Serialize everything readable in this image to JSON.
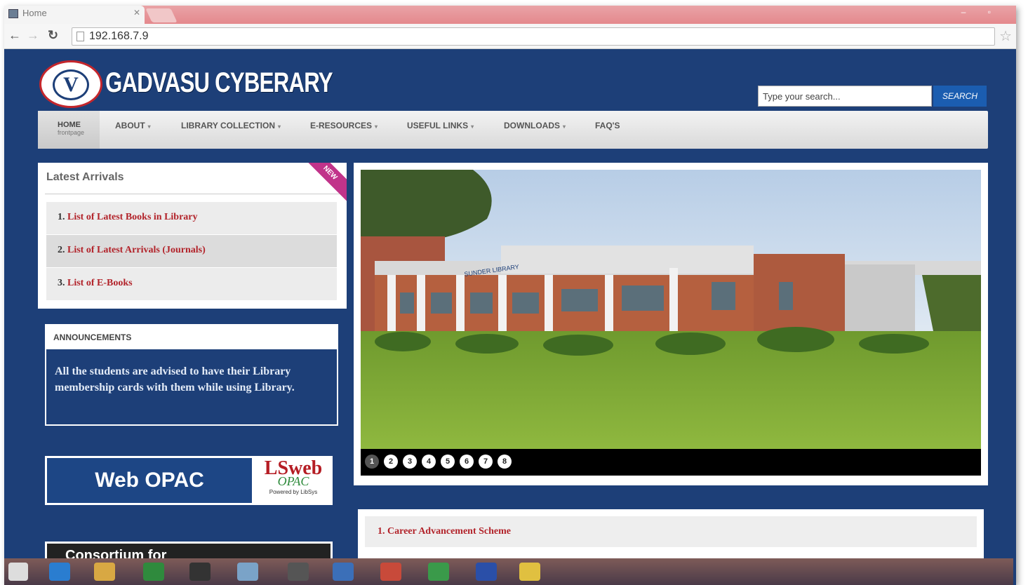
{
  "browser": {
    "tab_title": "Home",
    "url": "192.168.7.9"
  },
  "header": {
    "site_title": "GADVASU CYBERARY",
    "search_placeholder": "Type your search...",
    "search_button": "SEARCH"
  },
  "menu": {
    "home": {
      "label": "HOME",
      "sub": "frontpage"
    },
    "items": [
      {
        "label": "ABOUT",
        "has_dropdown": true
      },
      {
        "label": "LIBRARY COLLECTION",
        "has_dropdown": true
      },
      {
        "label": "E-RESOURCES",
        "has_dropdown": true
      },
      {
        "label": "USEFUL LINKS",
        "has_dropdown": true
      },
      {
        "label": "DOWNLOADS",
        "has_dropdown": true
      },
      {
        "label": "FAQ'S",
        "has_dropdown": false
      }
    ]
  },
  "latest_arrivals": {
    "title": "Latest Arrivals",
    "ribbon": "NEW",
    "items": [
      {
        "num": "1.",
        "label": "List of Latest Books in Library"
      },
      {
        "num": "2.",
        "label": "List of Latest Arrivals (Journals)"
      },
      {
        "num": "3.",
        "label": "List of E-Books"
      }
    ]
  },
  "announcements": {
    "title": "ANNOUNCEMENTS",
    "text": "All the students are advised to have their Library membership cards with them while using Library."
  },
  "opac": {
    "label": "Web OPAC",
    "logo_main": "LSweb",
    "logo_sub": "OPAC",
    "logo_powered": "Powered by LibSys"
  },
  "consortium": {
    "label": "Consortium for"
  },
  "slider": {
    "building_sign": "SUNDER LIBRARY",
    "dots": [
      "1",
      "2",
      "3",
      "4",
      "5",
      "6",
      "7",
      "8"
    ],
    "active_index": 0
  },
  "career": {
    "items": [
      {
        "label": "1. Career Advancement Scheme"
      }
    ]
  },
  "colors": {
    "page_bg": "#1d3f78",
    "link_red": "#b2232a",
    "search_button": "#1b5db0"
  }
}
